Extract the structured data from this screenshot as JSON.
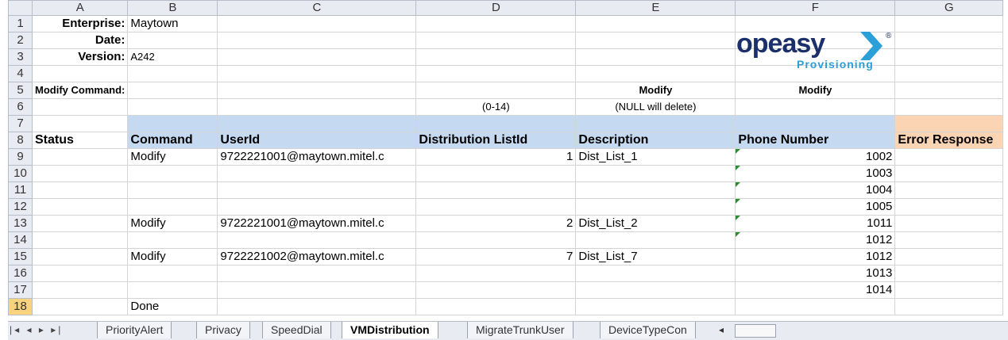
{
  "columns": [
    "A",
    "B",
    "C",
    "D",
    "E",
    "F",
    "G"
  ],
  "rows": [
    "1",
    "2",
    "3",
    "4",
    "5",
    "6",
    "7",
    "8",
    "9",
    "10",
    "11",
    "12",
    "13",
    "14",
    "15",
    "16",
    "17",
    "18"
  ],
  "selected_row": "18",
  "header_info": {
    "enterprise_label": "Enterprise:",
    "enterprise_value": "Maytown",
    "date_label": "Date:",
    "version_label": "Version:",
    "version_value": "A242",
    "modify_command_label": "Modify Command:",
    "modify_e": "Modify",
    "modify_f": "Modify",
    "hint_d": "(0-14)",
    "hint_e": "(NULL will delete)"
  },
  "table_headers": {
    "status": "Status",
    "command": "Command",
    "userid": "UserId",
    "distribution_listid": "Distribution ListId",
    "description": "Description",
    "phone_number": "Phone Number",
    "error_response": "Error Response"
  },
  "data_rows": [
    {
      "command": "Modify",
      "userid": "9722221001@maytown.mitel.c",
      "listid": "1",
      "description": "Dist_List_1",
      "phone": "1002"
    },
    {
      "command": "",
      "userid": "",
      "listid": "",
      "description": "",
      "phone": "1003"
    },
    {
      "command": "",
      "userid": "",
      "listid": "",
      "description": "",
      "phone": "1004"
    },
    {
      "command": "",
      "userid": "",
      "listid": "",
      "description": "",
      "phone": "1005"
    },
    {
      "command": "Modify",
      "userid": "9722221001@maytown.mitel.c",
      "listid": "2",
      "description": "Dist_List_2",
      "phone": "1011"
    },
    {
      "command": "",
      "userid": "",
      "listid": "",
      "description": "",
      "phone": "1012"
    },
    {
      "command": "Modify",
      "userid": "9722221002@maytown.mitel.c",
      "listid": "7",
      "description": "Dist_List_7",
      "phone": "1012"
    },
    {
      "command": "",
      "userid": "",
      "listid": "",
      "description": "",
      "phone": "1013"
    },
    {
      "command": "",
      "userid": "",
      "listid": "",
      "description": "",
      "phone": "1014"
    }
  ],
  "done_label": "Done",
  "logo": {
    "text": "opeasy",
    "sub": "Provisioning",
    "mark": "®",
    "color_dark": "#1b2f6b",
    "color_light": "#2a9fd8"
  },
  "tabs": [
    "PriorityAlert",
    "Privacy",
    "SpeedDial",
    "VMDistribution",
    "MigrateTrunkUser",
    "DeviceTypeCon"
  ],
  "active_tab": "VMDistribution",
  "colors": {
    "header_blue": "#c5d9f1",
    "header_orange": "#fbd4b4",
    "selected_row": "#f8d27c"
  }
}
